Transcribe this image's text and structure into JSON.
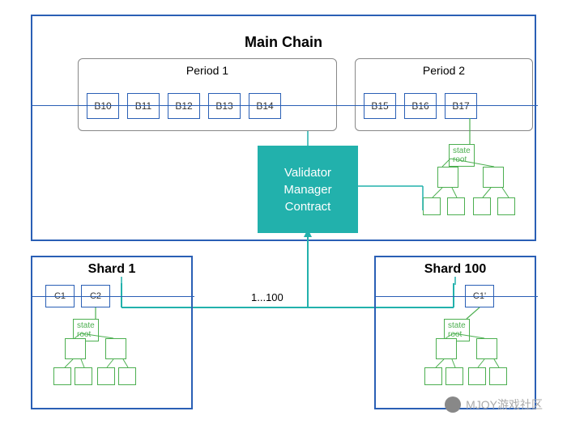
{
  "main_chain": {
    "title": "Main Chain",
    "period1": {
      "label": "Period 1",
      "blocks": [
        "B10",
        "B11",
        "B12",
        "B13",
        "B14"
      ]
    },
    "period2": {
      "label": "Period 2",
      "blocks": [
        "B15",
        "B16",
        "B17"
      ]
    },
    "vmc": {
      "line1": "Validator",
      "line2": "Manager",
      "line3": "Contract"
    },
    "state_root_label": "state root"
  },
  "shard1": {
    "title": "Shard 1",
    "blocks": [
      "C1",
      "C2"
    ],
    "state_root_label": "state root"
  },
  "shard100": {
    "title": "Shard 100",
    "blocks": [
      "C1'"
    ],
    "state_root_label": "state root"
  },
  "connector_label": "1...100",
  "watermark": "MJOY游戏社区",
  "colors": {
    "border": "#2a5fb5",
    "accent": "#22b1ac",
    "tree": "#4caf50"
  }
}
